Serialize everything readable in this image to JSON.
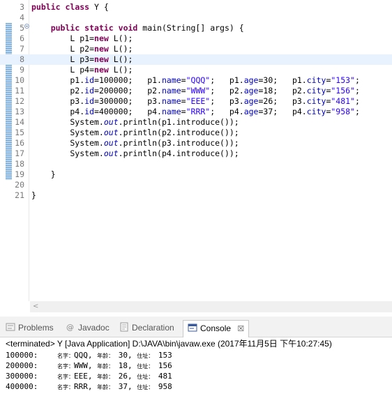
{
  "editor": {
    "lines": [
      {
        "num": "3",
        "seg": [
          {
            "t": "public ",
            "c": "kw"
          },
          {
            "t": "class ",
            "c": "kw"
          },
          {
            "t": "Y {",
            "c": ""
          }
        ]
      },
      {
        "num": "4",
        "seg": []
      },
      {
        "num": "5",
        "seg": [
          {
            "t": "    ",
            "c": ""
          },
          {
            "t": "public ",
            "c": "kw"
          },
          {
            "t": "static ",
            "c": "kw"
          },
          {
            "t": "void ",
            "c": "kw"
          },
          {
            "t": "main(String[] args) {",
            "c": ""
          }
        ]
      },
      {
        "num": "6",
        "seg": [
          {
            "t": "        L p1=",
            "c": ""
          },
          {
            "t": "new ",
            "c": "kw"
          },
          {
            "t": "L();",
            "c": ""
          }
        ]
      },
      {
        "num": "7",
        "seg": [
          {
            "t": "        L p2=",
            "c": ""
          },
          {
            "t": "new ",
            "c": "kw"
          },
          {
            "t": "L();",
            "c": ""
          }
        ]
      },
      {
        "num": "8",
        "seg": [
          {
            "t": "        L p3=",
            "c": ""
          },
          {
            "t": "new ",
            "c": "kw"
          },
          {
            "t": "L();",
            "c": ""
          }
        ]
      },
      {
        "num": "9",
        "seg": [
          {
            "t": "        L p4=",
            "c": ""
          },
          {
            "t": "new ",
            "c": "kw"
          },
          {
            "t": "L();",
            "c": ""
          }
        ]
      },
      {
        "num": "10",
        "seg": [
          {
            "t": "        p1.",
            "c": ""
          },
          {
            "t": "id",
            "c": "fld"
          },
          {
            "t": "=100000;   p1.",
            "c": ""
          },
          {
            "t": "name",
            "c": "fld"
          },
          {
            "t": "=",
            "c": ""
          },
          {
            "t": "\"QQQ\"",
            "c": "str"
          },
          {
            "t": ";   p1.",
            "c": ""
          },
          {
            "t": "age",
            "c": "fld"
          },
          {
            "t": "=30;   p1.",
            "c": ""
          },
          {
            "t": "city",
            "c": "fld"
          },
          {
            "t": "=",
            "c": ""
          },
          {
            "t": "\"153\"",
            "c": "str"
          },
          {
            "t": ";",
            "c": ""
          }
        ]
      },
      {
        "num": "11",
        "seg": [
          {
            "t": "        p2.",
            "c": ""
          },
          {
            "t": "id",
            "c": "fld"
          },
          {
            "t": "=200000;   p2.",
            "c": ""
          },
          {
            "t": "name",
            "c": "fld"
          },
          {
            "t": "=",
            "c": ""
          },
          {
            "t": "\"WWW\"",
            "c": "str"
          },
          {
            "t": ";   p2.",
            "c": ""
          },
          {
            "t": "age",
            "c": "fld"
          },
          {
            "t": "=18;   p2.",
            "c": ""
          },
          {
            "t": "city",
            "c": "fld"
          },
          {
            "t": "=",
            "c": ""
          },
          {
            "t": "\"156\"",
            "c": "str"
          },
          {
            "t": ";",
            "c": ""
          }
        ]
      },
      {
        "num": "12",
        "seg": [
          {
            "t": "        p3.",
            "c": ""
          },
          {
            "t": "id",
            "c": "fld"
          },
          {
            "t": "=300000;   p3.",
            "c": ""
          },
          {
            "t": "name",
            "c": "fld"
          },
          {
            "t": "=",
            "c": ""
          },
          {
            "t": "\"EEE\"",
            "c": "str"
          },
          {
            "t": ";   p3.",
            "c": ""
          },
          {
            "t": "age",
            "c": "fld"
          },
          {
            "t": "=26;   p3.",
            "c": ""
          },
          {
            "t": "city",
            "c": "fld"
          },
          {
            "t": "=",
            "c": ""
          },
          {
            "t": "\"481\"",
            "c": "str"
          },
          {
            "t": ";",
            "c": ""
          }
        ]
      },
      {
        "num": "13",
        "seg": [
          {
            "t": "        p4.",
            "c": ""
          },
          {
            "t": "id",
            "c": "fld"
          },
          {
            "t": "=400000;   p4.",
            "c": ""
          },
          {
            "t": "name",
            "c": "fld"
          },
          {
            "t": "=",
            "c": ""
          },
          {
            "t": "\"RRR\"",
            "c": "str"
          },
          {
            "t": ";   p4.",
            "c": ""
          },
          {
            "t": "age",
            "c": "fld"
          },
          {
            "t": "=37;   p4.",
            "c": ""
          },
          {
            "t": "city",
            "c": "fld"
          },
          {
            "t": "=",
            "c": ""
          },
          {
            "t": "\"958\"",
            "c": "str"
          },
          {
            "t": ";",
            "c": ""
          }
        ]
      },
      {
        "num": "14",
        "seg": [
          {
            "t": "        System.",
            "c": ""
          },
          {
            "t": "out",
            "c": "st"
          },
          {
            "t": ".println(p1.introduce());",
            "c": ""
          }
        ]
      },
      {
        "num": "15",
        "seg": [
          {
            "t": "        System.",
            "c": ""
          },
          {
            "t": "out",
            "c": "st"
          },
          {
            "t": ".println(p2.introduce());",
            "c": ""
          }
        ]
      },
      {
        "num": "16",
        "seg": [
          {
            "t": "        System.",
            "c": ""
          },
          {
            "t": "out",
            "c": "st"
          },
          {
            "t": ".println(p3.introduce());",
            "c": ""
          }
        ]
      },
      {
        "num": "17",
        "seg": [
          {
            "t": "        System.",
            "c": ""
          },
          {
            "t": "out",
            "c": "st"
          },
          {
            "t": ".println(p4.introduce());",
            "c": ""
          }
        ]
      },
      {
        "num": "18",
        "seg": []
      },
      {
        "num": "19",
        "seg": [
          {
            "t": "    }",
            "c": ""
          }
        ]
      },
      {
        "num": "20",
        "seg": []
      },
      {
        "num": "21",
        "seg": [
          {
            "t": "}",
            "c": ""
          }
        ]
      }
    ],
    "scroll_left_glyph": "<"
  },
  "tabs": {
    "problems": "Problems",
    "javadoc": "Javadoc",
    "declaration": "Declaration",
    "console": "Console",
    "console_close": "☒"
  },
  "console": {
    "status": "<terminated> Y [Java Application] D:\\JAVA\\bin\\javaw.exe (2017年11月5日 下午10:27:45)",
    "output": [
      {
        "id": "100000:",
        "name_label": "名字：",
        "name": "QQQ",
        "age_label": "年龄：",
        "age": "30",
        "addr_label": "住址：",
        "city": "153"
      },
      {
        "id": "200000:",
        "name_label": "名字：",
        "name": "WWW",
        "age_label": "年龄：",
        "age": "18",
        "addr_label": "住址：",
        "city": "156"
      },
      {
        "id": "300000:",
        "name_label": "名字：",
        "name": "EEE",
        "age_label": "年龄：",
        "age": "26",
        "addr_label": "住址：",
        "city": "481"
      },
      {
        "id": "400000:",
        "name_label": "名字：",
        "name": "RRR",
        "age_label": "年龄：",
        "age": "37",
        "addr_label": "住址：",
        "city": "958"
      }
    ]
  },
  "colors": {
    "keyword": "#7f0055",
    "string": "#2a00ff",
    "field": "#0000c0",
    "current_line": "#e8f2fe"
  }
}
